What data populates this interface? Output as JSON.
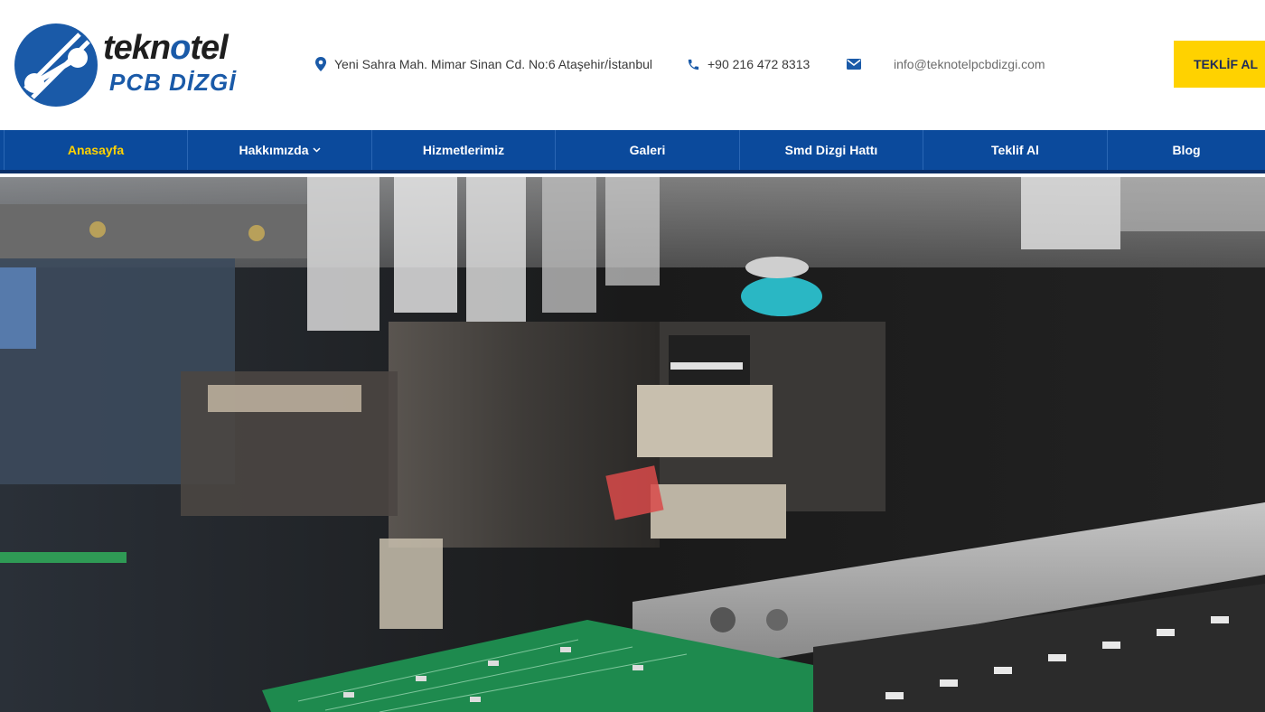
{
  "brand": {
    "name_part1": "tekn",
    "name_o": "o",
    "name_part2": "tel",
    "subtitle": "PCB DİZGİ",
    "colors": {
      "primary": "#1a5aa8",
      "accent": "#ffd200",
      "nav": "#0b4a9c"
    }
  },
  "contact": {
    "address": "Yeni Sahra Mah. Mimar Sinan Cd. No:6 Ataşehir/İstanbul",
    "address_icon": "location-pin-icon",
    "phone": "+90 216 472 8313",
    "phone_icon": "phone-icon",
    "email": "info@teknotelpcbdizgi.com",
    "email_icon": "envelope-icon"
  },
  "cta": {
    "label": "TEKLİF AL",
    "icon": "arrow-icon"
  },
  "nav": {
    "items": [
      {
        "label": "Anasayfa",
        "active": true
      },
      {
        "label": "Hakkımızda",
        "has_dropdown": true
      },
      {
        "label": "Hizmetlerimiz"
      },
      {
        "label": "Galeri"
      },
      {
        "label": "Smd Dizgi Hattı"
      },
      {
        "label": "Teklif Al"
      },
      {
        "label": "Blog"
      }
    ]
  },
  "hero": {
    "image": "smd-pick-and-place-machine-photo"
  }
}
